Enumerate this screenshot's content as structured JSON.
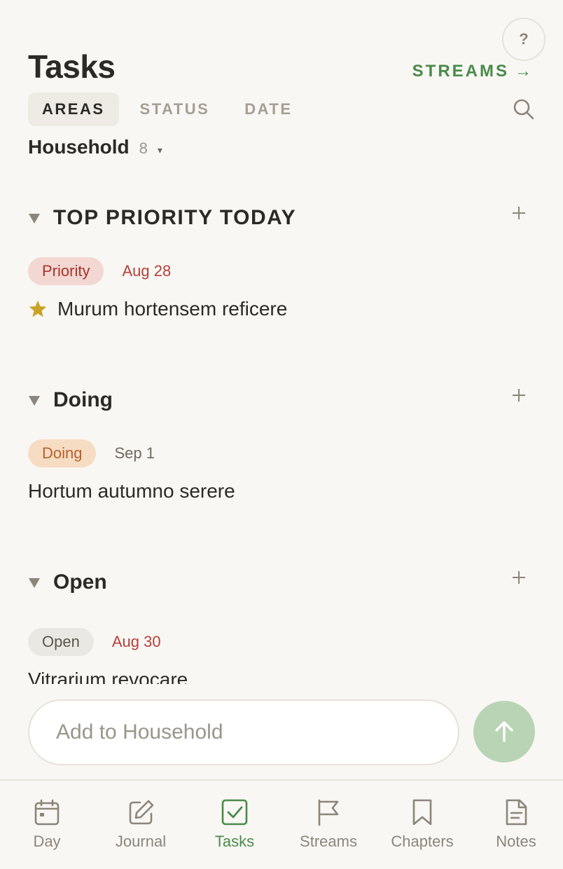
{
  "header": {
    "title": "Tasks",
    "help_label": "?",
    "streams_link": "STREAMS",
    "streams_arrow": "→"
  },
  "tabs": [
    {
      "label": "AREAS",
      "active": true
    },
    {
      "label": "STATUS",
      "active": false
    },
    {
      "label": "DATE",
      "active": false
    }
  ],
  "area": {
    "name": "Household",
    "count": "8",
    "caret": "▾"
  },
  "sections": [
    {
      "title": "TOP PRIORITY TODAY",
      "tasks": [
        {
          "status": "Priority",
          "date": "Aug 28",
          "title": "Murum hortensem reficere",
          "starred": true
        }
      ]
    },
    {
      "title": "Doing",
      "tasks": [
        {
          "status": "Doing",
          "date": "Sep 1",
          "title": "Hortum autumno serere",
          "starred": false
        }
      ]
    },
    {
      "title": "Open",
      "tasks": [
        {
          "status": "Open",
          "date": "Aug 30",
          "title": "Vitrarium revocare",
          "starred": false
        }
      ]
    }
  ],
  "composer": {
    "placeholder": "Add to Household"
  },
  "nav": [
    {
      "label": "Day",
      "icon": "calendar-icon",
      "active": false
    },
    {
      "label": "Journal",
      "icon": "edit-icon",
      "active": false
    },
    {
      "label": "Tasks",
      "icon": "checkbox-icon",
      "active": true
    },
    {
      "label": "Streams",
      "icon": "flag-icon",
      "active": false
    },
    {
      "label": "Chapters",
      "icon": "bookmark-icon",
      "active": false
    },
    {
      "label": "Notes",
      "icon": "note-icon",
      "active": false
    }
  ],
  "colors": {
    "background": "#f9f7f3",
    "accent_green": "#4a8a4c",
    "priority_red": "#a8332b",
    "doing_orange": "#b4622a",
    "send_button": "#b8d4b5",
    "star": "#c9a227"
  }
}
